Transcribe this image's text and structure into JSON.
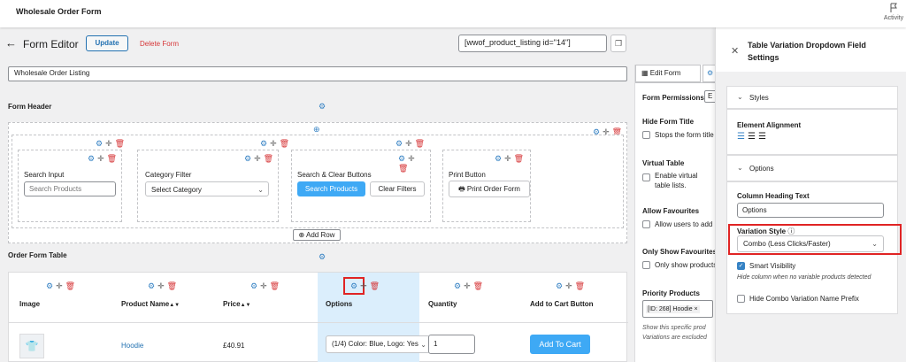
{
  "app_title": "Wholesale Order Form",
  "activity_label": "Activity",
  "editor": {
    "title": "Form Editor",
    "update_label": "Update",
    "delete_label": "Delete Form",
    "shortcode": "[wwof_product_listing id=\"14\"]",
    "form_name": "Wholesale Order Listing"
  },
  "form_header": {
    "label": "Form Header",
    "search_input": {
      "label": "Search Input",
      "placeholder": "Search Products"
    },
    "category_filter": {
      "label": "Category Filter",
      "value": "Select Category"
    },
    "search_clear": {
      "label": "Search & Clear Buttons",
      "search_btn": "Search Products",
      "clear_btn": "Clear Filters"
    },
    "print_button": {
      "label": "Print Button",
      "btn": "Print Order Form"
    },
    "add_row": "Add Row"
  },
  "order_table": {
    "label": "Order Form Table",
    "columns": [
      "Image",
      "Product Name",
      "Price",
      "Options",
      "Quantity",
      "Add to Cart Button"
    ],
    "sort_arrows": "▲▼",
    "row": {
      "product": "Hoodie",
      "price": "£40.91",
      "options": "(1/4) Color: Blue, Logo: Yes",
      "quantity": "1",
      "add_to_cart": "Add To Cart"
    }
  },
  "right_panel": {
    "tab_edit": "Edit Form",
    "permissions_label": "Form Permissions",
    "permissions_value": "E",
    "sections": [
      {
        "title": "Hide Form Title",
        "text": "Stops the form title"
      },
      {
        "title": "Virtual Table",
        "text": "Enable virtual table lists."
      },
      {
        "title": "Allow Favourites",
        "text": "Allow users to add"
      },
      {
        "title": "Only Show Favourites",
        "text": "Only show products"
      }
    ],
    "priority_title": "Priority Products",
    "priority_tag": "[ID: 268] Hoodie",
    "priority_note": "Show this specific prod Variations are excluded"
  },
  "settings": {
    "title": "Table Variation Dropdown Field Settings",
    "styles_label": "Styles",
    "alignment_label": "Element Alignment",
    "options_label": "Options",
    "heading_label": "Column Heading Text",
    "heading_value": "Options",
    "variation_label": "Variation Style",
    "variation_value": "Combo (Less Clicks/Faster)",
    "smart_visibility": "Smart Visibility",
    "smart_note": "Hide column when no variable products detected",
    "hide_prefix": "Hide Combo Variation Name Prefix"
  },
  "colors": {
    "accent": "#3582c4",
    "button": "#3ea9f5",
    "danger": "#d63638",
    "highlight": "#e02424",
    "selected_col": "#dbeefc"
  }
}
